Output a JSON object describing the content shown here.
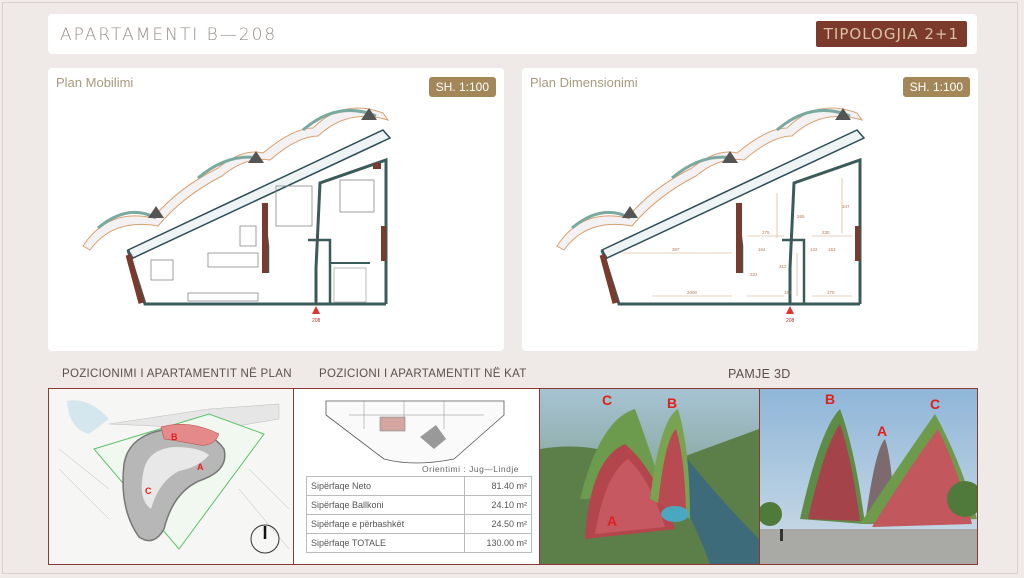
{
  "header": {
    "title": "APARTAMENTI B—208",
    "typology": "TIPOLOGJIA 2+1"
  },
  "plans": [
    {
      "title": "Plan Mobilimi",
      "scale": "SH. 1:100"
    },
    {
      "title": "Plan Dimensionimi",
      "scale": "SH. 1:100"
    }
  ],
  "sections": {
    "position_plan": "POZICIONIMI I APARTAMENTIT NË PLAN",
    "position_floor": "POZICIONI I APARTAMENTIT NË KAT",
    "view_3d": "PAMJE 3D"
  },
  "orientation": "Orientimi : Jug—Lindje",
  "areas": [
    {
      "label": "Sipërfaqe Neto",
      "value": "81.40 m²"
    },
    {
      "label": "Sipërfaqe Ballkoni",
      "value": "24.10 m²"
    },
    {
      "label": "Sipërfaqe e përbashkët",
      "value": "24.50 m²"
    },
    {
      "label": "Sipërfaqe TOTALE",
      "value": "130.00 m²"
    }
  ],
  "site_labels": {
    "a": "A",
    "b": "B",
    "c": "C"
  },
  "photo1_labels": {
    "a": "A",
    "b": "B",
    "c": "C"
  },
  "photo2_labels": {
    "a": "A",
    "b": "B",
    "c": "C"
  },
  "dimension_labels": [
    "387",
    "275",
    "230",
    "164",
    "132",
    "163",
    "222",
    "2000",
    "183",
    "270",
    "312",
    "265",
    "347"
  ],
  "marker_label": "208",
  "colors": {
    "accent": "#7b3a2c",
    "badge": "#a48759",
    "border": "#8b3a33",
    "wall": "#3b5a5a"
  }
}
